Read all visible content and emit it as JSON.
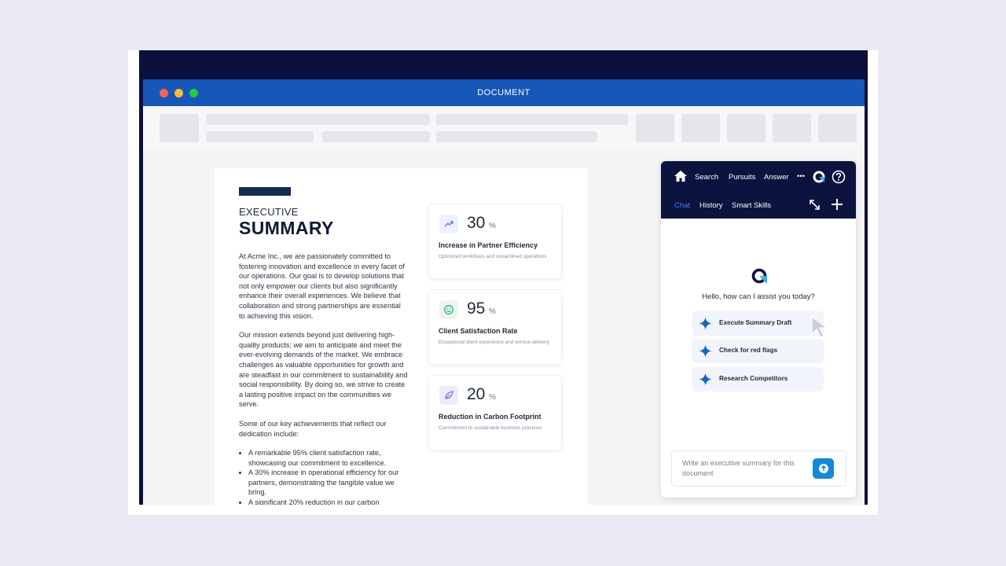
{
  "window": {
    "title": "DOCUMENT"
  },
  "document": {
    "heading_small": "EXECUTIVE",
    "heading_large": "SUMMARY",
    "paragraphs": [
      "At Acme Inc., we are passionately committed to fostering innovation and excellence in every facet of our operations. Our goal is to develop solutions that not only empower our clients but also significantly enhance their overall experiences. We believe that collaboration and strong partnerships are essential to achieving this vision.",
      "Our mission extends beyond just delivering high-quality products; we aim to anticipate and meet the ever-evolving demands of the market. We embrace challenges as valuable opportunities for growth and are steadfast in our commitment to sustainability and social responsibility. By doing so, we strive to create a lasting positive impact on the communities we serve.",
      "Some of our key achievements that reflect our dedication include:"
    ],
    "bullets": [
      "A remarkable 95% client satisfaction rate, showcasing our commitment to excellence.",
      "A 30% increase in operational efficiency for our partners, demonstrating the tangible value we bring.",
      "A significant 20% reduction in our carbon"
    ]
  },
  "stats": [
    {
      "value": "30",
      "unit": "%",
      "label": "Increase in Partner Efficiency",
      "sub": "Optimized workflows and streamlined operations",
      "icon": "trend-up-icon",
      "icon_color": "#6b7bd6",
      "icon_bg": "#eef2ff"
    },
    {
      "value": "95",
      "unit": "%",
      "label": "Client Satisfaction Rate",
      "sub": "Exceptional client experience and service delivery",
      "icon": "smile-icon",
      "icon_color": "#22a06b",
      "icon_bg": "#e8f8ef"
    },
    {
      "value": "20",
      "unit": "%",
      "label": "Reduction in Carbon Footprint",
      "sub": "Commitment to sustainable business practices",
      "icon": "leaf-icon",
      "icon_color": "#8b6cd6",
      "icon_bg": "#efeafd"
    }
  ],
  "assistant": {
    "nav": {
      "search": "Search",
      "pursuits": "Pursuits",
      "answer": "Answer",
      "more": "•••"
    },
    "tabs": {
      "chat": "Chat",
      "history": "History",
      "smart_skills": "Smart Skills"
    },
    "greeting": "Hello, how can I assist you today?",
    "suggestions": [
      "Execute Summary Draft",
      "Check for red flags",
      "Research Competitors"
    ],
    "input_placeholder": "Write an executive summary for this document"
  },
  "colors": {
    "titlebar": "#1657b7",
    "assistant_header": "#0c133f",
    "active_tab": "#3b82f6",
    "send_button": "#1687d9"
  }
}
